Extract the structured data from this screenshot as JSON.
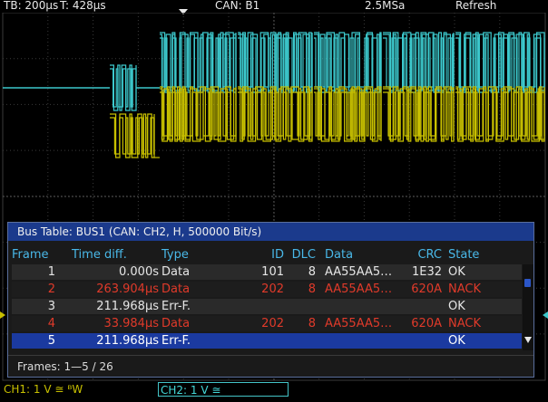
{
  "topbar": {
    "timebase": "TB: 200µs",
    "trigger_time": "T: 428µs",
    "trigger_source": "CAN: B1",
    "sample_rate": "2.5MSa",
    "mode": "Refresh"
  },
  "colors": {
    "ch1": "#c8c000",
    "ch2": "#3cc8cc",
    "grid": "#3a3a3a",
    "table_title": "#1b3a8c",
    "selected_row": "#1b3aa0",
    "error_row": "#e03a2a",
    "header_text": "#49b8e8"
  },
  "bus_table": {
    "title": "Bus Table: BUS1 (CAN: CH2, H, 500000 Bit/s)",
    "columns": [
      "Frame",
      "Time diff.",
      "Type",
      "ID",
      "DLC",
      "Data",
      "CRC",
      "State"
    ],
    "rows": [
      {
        "frame": "1",
        "time": "0.000s",
        "type": "Data",
        "id": "101",
        "dlc": "8",
        "data": "AA55AA5…",
        "crc": "1E32",
        "state": "OK"
      },
      {
        "frame": "2",
        "time": "263.904µs",
        "type": "Data",
        "id": "202",
        "dlc": "8",
        "data": "AA55AA5…",
        "crc": "620A",
        "state": "NACK"
      },
      {
        "frame": "3",
        "time": "211.968µs",
        "type": "Err-F.",
        "id": "",
        "dlc": "",
        "data": "",
        "crc": "",
        "state": "OK"
      },
      {
        "frame": "4",
        "time": "33.984µs",
        "type": "Data",
        "id": "202",
        "dlc": "8",
        "data": "AA55AA5…",
        "crc": "620A",
        "state": "NACK"
      },
      {
        "frame": "5",
        "time": "211.968µs",
        "type": "Err-F.",
        "id": "",
        "dlc": "",
        "data": "",
        "crc": "",
        "state": "OK"
      }
    ],
    "footer": "Frames: 1—5 / 26"
  },
  "channels": {
    "ch1": "CH1: 1 V ≅ ᴮW",
    "ch2": "CH2: 1 V ≅"
  },
  "icons": {
    "trigger_marker": "triangle-down-icon",
    "scroll_down": "triangle-down-icon",
    "scroll_thumb": "scroll-thumb"
  }
}
